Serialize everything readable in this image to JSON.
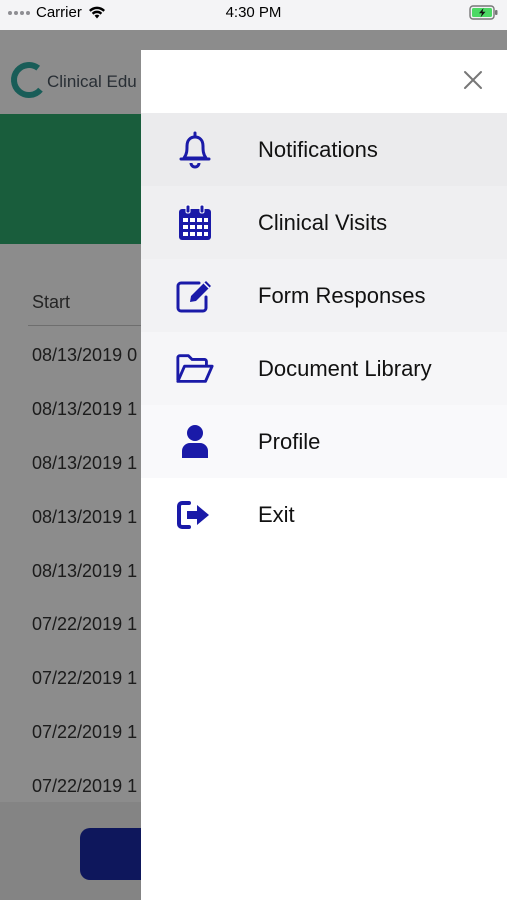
{
  "status_bar": {
    "carrier": "Carrier",
    "time": "4:30 PM"
  },
  "background": {
    "app_name": "Clinical Edu",
    "column_header": "Start",
    "rows": [
      "08/13/2019 0",
      "08/13/2019 1",
      "08/13/2019 1",
      "08/13/2019 1",
      "08/13/2019 1",
      "07/22/2019 1",
      "07/22/2019 1",
      "07/22/2019 1",
      "07/22/2019 1"
    ]
  },
  "drawer": {
    "menu": [
      {
        "label": "Notifications",
        "icon": "bell-icon"
      },
      {
        "label": "Clinical Visits",
        "icon": "calendar-icon"
      },
      {
        "label": "Form Responses",
        "icon": "edit-icon"
      },
      {
        "label": "Document Library",
        "icon": "folder-open-icon"
      },
      {
        "label": "Profile",
        "icon": "user-icon"
      },
      {
        "label": "Exit",
        "icon": "sign-out-icon"
      }
    ]
  },
  "colors": {
    "icon": "#1a1aa8",
    "banner": "#2eaa6e",
    "button": "#1a2aa8"
  }
}
